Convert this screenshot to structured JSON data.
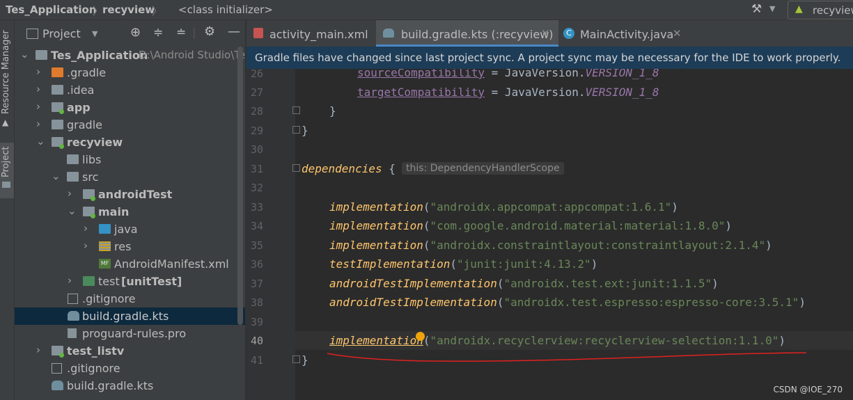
{
  "breadcrumb": {
    "project": "Tes_Application",
    "module": "recyview",
    "context": "<class initializer>"
  },
  "run_config": {
    "label": "recyview"
  },
  "leftbar": {
    "resource_manager": "Resource Manager",
    "project": "Project"
  },
  "project_panel": {
    "title": "Project",
    "tree": [
      {
        "label": "Tes_Application",
        "suffix": "D:\\Android Studio\\Te",
        "bold": true
      },
      {
        "label": ".gradle"
      },
      {
        "label": ".idea"
      },
      {
        "label": "app",
        "bold": true
      },
      {
        "label": "gradle"
      },
      {
        "label": "recyview",
        "bold": true
      },
      {
        "label": "libs"
      },
      {
        "label": "src"
      },
      {
        "label": "androidTest",
        "bold": true
      },
      {
        "label": "main",
        "bold": true
      },
      {
        "label": "java"
      },
      {
        "label": "res"
      },
      {
        "label": "AndroidManifest.xml"
      },
      {
        "label": "test",
        "suffix": "[unitTest]"
      },
      {
        "label": ".gitignore"
      },
      {
        "label": "build.gradle.kts"
      },
      {
        "label": "proguard-rules.pro"
      },
      {
        "label": "test_listv",
        "bold": true
      },
      {
        "label": ".gitignore"
      },
      {
        "label": "build.gradle.kts"
      }
    ]
  },
  "tabs": [
    {
      "label": "activity_main.xml"
    },
    {
      "label": "build.gradle.kts (:recyview)"
    },
    {
      "label": "MainActivity.java"
    }
  ],
  "banner": {
    "text": "Gradle files have changed since last project sync. A project sync may be necessary for the IDE to work properly."
  },
  "editor": {
    "line_numbers": [
      "26",
      "27",
      "28",
      "29",
      "30",
      "31",
      "32",
      "33",
      "34",
      "35",
      "36",
      "37",
      "38",
      "39",
      "40",
      "41"
    ],
    "code": {
      "l26_prop": "sourceCompatibility",
      "l26_rest": " = JavaVersion.",
      "l26_const": "VERSION_1_8",
      "l27_prop": "targetCompatibility",
      "l27_rest": " = JavaVersion.",
      "l27_const": "VERSION_1_8",
      "brace_close": "}",
      "deps_kw": "dependencies",
      "deps_brace": " {",
      "deps_hint": "this: DependencyHandlerScope",
      "l33_fn": "implementation",
      "l33_str": "\"androidx.appcompat:appcompat:1.6.1\"",
      "l34_fn": "implementation",
      "l34_str": "\"com.google.android.material:material:1.8.0\"",
      "l35_fn": "implementation",
      "l35_str": "\"androidx.constraintlayout:constraintlayout:2.1.4\"",
      "l36_fn": "testImplementation",
      "l36_str": "\"junit:junit:4.13.2\"",
      "l37_fn": "androidTestImplementation",
      "l37_str": "\"androidx.test.ext:junit:1.1.5\"",
      "l38_fn": "androidTestImplementation",
      "l38_str": "\"androidx.test.espresso:espresso-core:3.5.1\"",
      "l40_fn": "implementation",
      "l40_str": "\"androidx.recyclerview:recyclerview-selection:1.1.0\""
    }
  },
  "watermark": "CSDN @IOE_270",
  "colors": {
    "annotation_line": "#e0211f",
    "intention_bulb": "#f0a30a"
  }
}
